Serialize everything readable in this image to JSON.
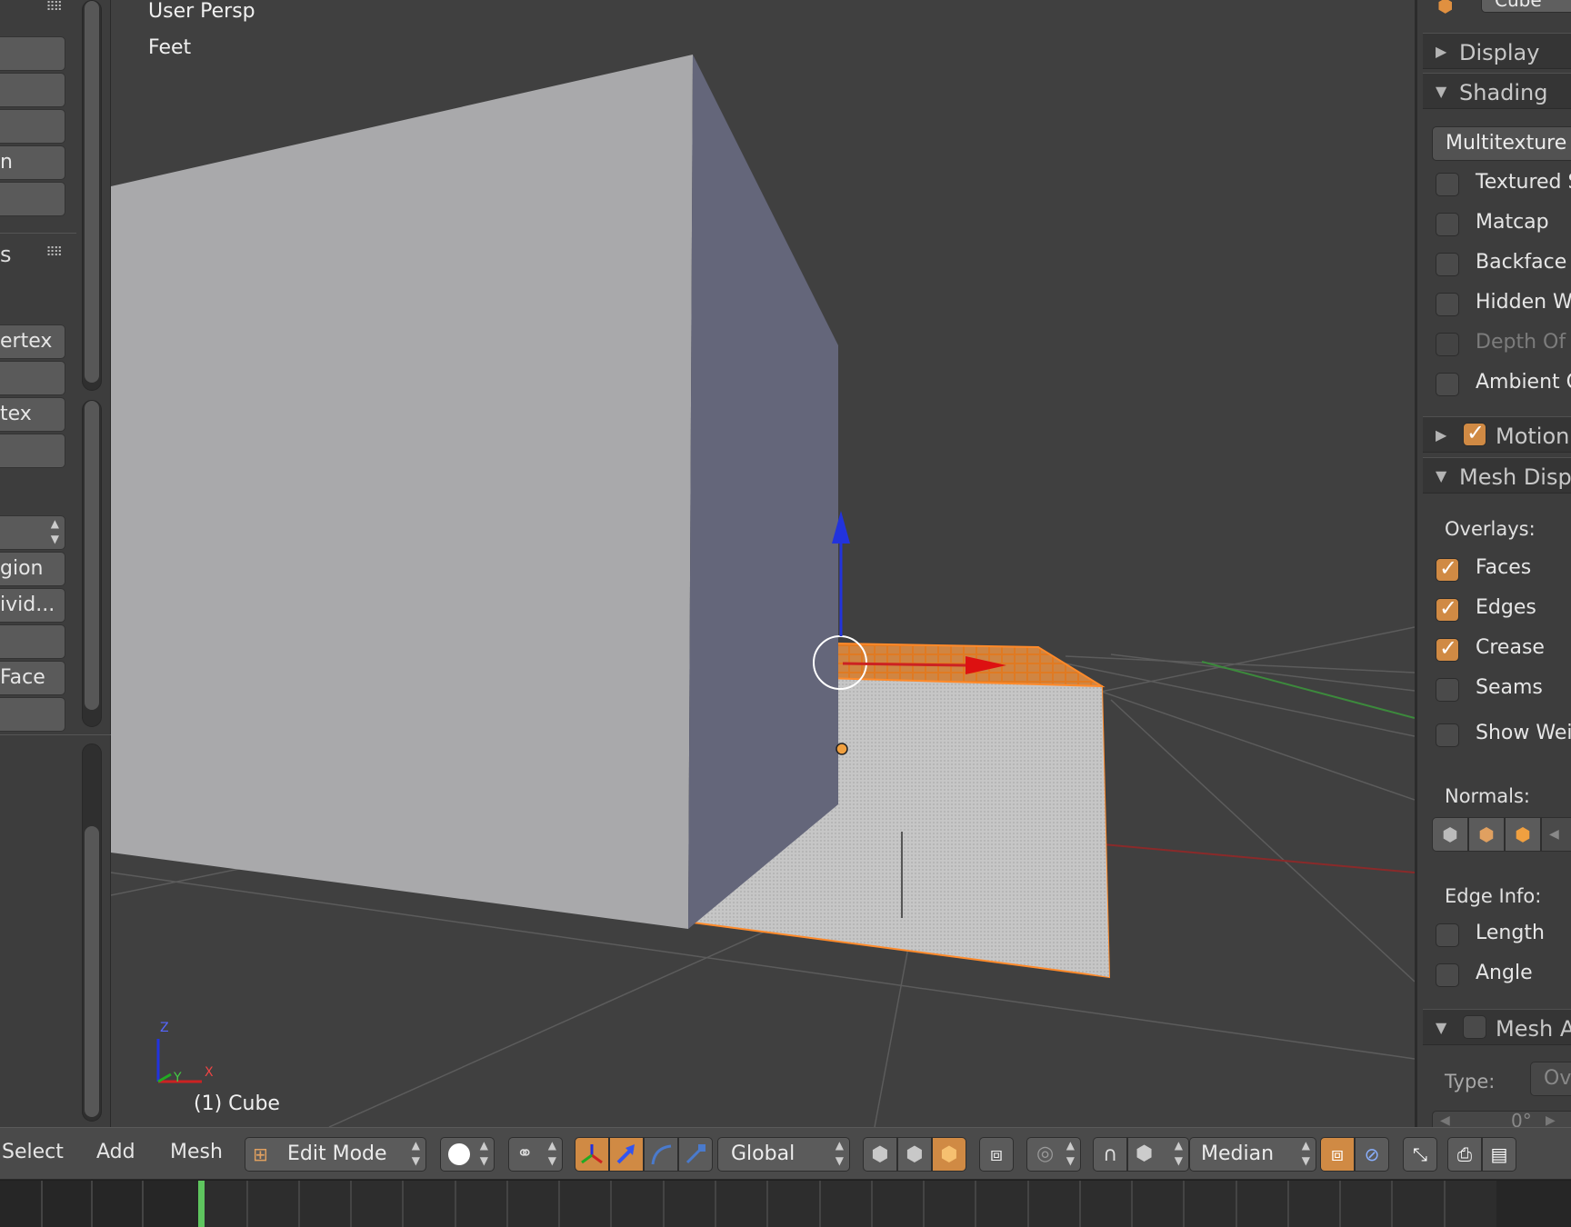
{
  "viewport": {
    "view_name": "User Persp",
    "units": "Feet",
    "object_label": "(1) Cube",
    "axis_z": "Z",
    "axis_y": "Y",
    "axis_x": "X"
  },
  "tool_shelf": {
    "tab_fragment_1": "s",
    "buttons": [
      "n",
      "ertex",
      "tex",
      "gion",
      "ivid...",
      "Face"
    ]
  },
  "properties": {
    "object_name": "Cube",
    "sections": {
      "display": "Display",
      "shading": "Shading",
      "motion": "Motion T",
      "mesh_display": "Mesh Displ",
      "mesh_analysis": "Mesh An"
    },
    "shading_mode": "Multitexture",
    "shading_options": [
      {
        "label": "Textured S",
        "checked": false,
        "disabled": false
      },
      {
        "label": "Matcap",
        "checked": false,
        "disabled": false
      },
      {
        "label": "Backface C",
        "checked": false,
        "disabled": false
      },
      {
        "label": "Hidden Wi",
        "checked": false,
        "disabled": false
      },
      {
        "label": "Depth Of F",
        "checked": false,
        "disabled": true
      },
      {
        "label": "Ambient O",
        "checked": false,
        "disabled": false
      }
    ],
    "overlays_label": "Overlays:",
    "overlays": [
      {
        "label": "Faces",
        "checked": true
      },
      {
        "label": "Edges",
        "checked": true
      },
      {
        "label": "Crease",
        "checked": true
      },
      {
        "label": "Seams",
        "checked": false
      },
      {
        "label": "Show Weig",
        "checked": false
      }
    ],
    "normals_label": "Normals:",
    "edge_info_label": "Edge Info:",
    "edge_info": [
      {
        "label": "Length",
        "checked": false
      },
      {
        "label": "Angle",
        "checked": false
      }
    ],
    "type_label": "Type:",
    "type_value": "Ove",
    "angle_value": "0°"
  },
  "header": {
    "menus": [
      "Select",
      "Add",
      "Mesh"
    ],
    "mode": "Edit Mode",
    "orientation": "Global",
    "pivot": "Median"
  },
  "colors": {
    "accent": "#d08a44",
    "selection": "#ff8a2a",
    "axis_x": "#cc2222",
    "axis_y": "#22aa22",
    "axis_z": "#2233dd",
    "frame_cursor": "#5ec55e"
  }
}
